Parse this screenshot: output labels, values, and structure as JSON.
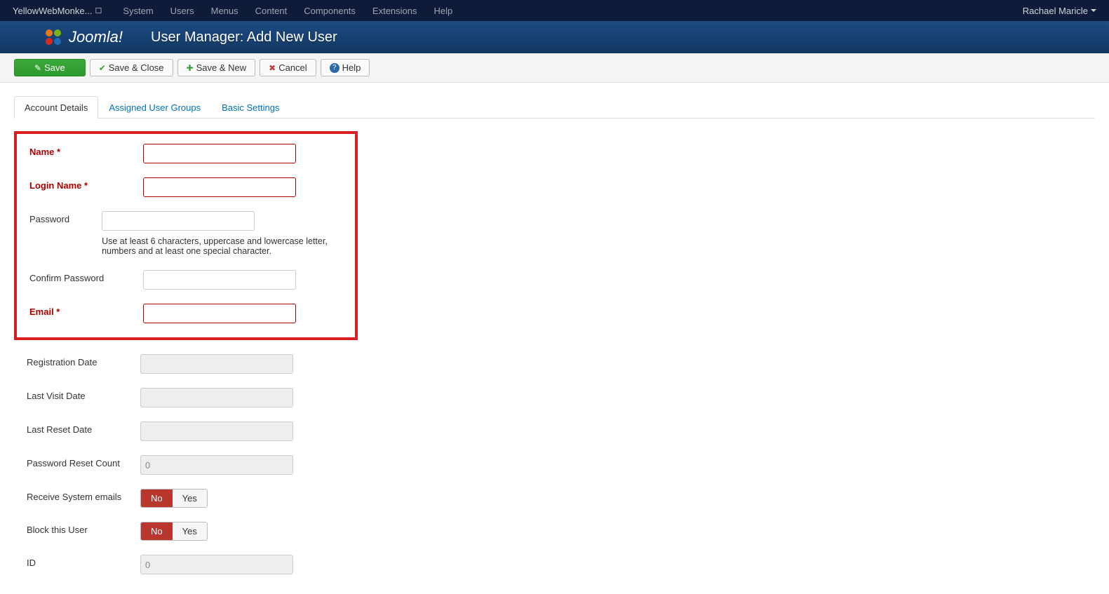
{
  "topbar": {
    "site": "YellowWebMonke...",
    "ext_icon": "↗",
    "menu": [
      "System",
      "Users",
      "Menus",
      "Content",
      "Components",
      "Extensions",
      "Help"
    ],
    "user": "Rachael Maricle"
  },
  "header": {
    "brand": "Joomla!",
    "title": "User Manager: Add New User"
  },
  "toolbar": {
    "save": "Save",
    "save_close": "Save & Close",
    "save_new": "Save & New",
    "cancel": "Cancel",
    "help": "Help"
  },
  "tabs": [
    "Account Details",
    "Assigned User Groups",
    "Basic Settings"
  ],
  "form": {
    "name": {
      "label": "Name *"
    },
    "login": {
      "label": "Login Name *"
    },
    "password": {
      "label": "Password",
      "hint": "Use at least 6 characters, uppercase and lowercase letter, numbers and at least one special character."
    },
    "confirm": {
      "label": "Confirm Password"
    },
    "email": {
      "label": "Email *"
    },
    "reg_date": {
      "label": "Registration Date",
      "value": ""
    },
    "last_visit": {
      "label": "Last Visit Date",
      "value": ""
    },
    "last_reset": {
      "label": "Last Reset Date",
      "value": ""
    },
    "reset_count": {
      "label": "Password Reset Count",
      "value": "0"
    },
    "receive": {
      "label": "Receive System emails",
      "no": "No",
      "yes": "Yes"
    },
    "block": {
      "label": "Block this User",
      "no": "No",
      "yes": "Yes"
    },
    "id": {
      "label": "ID",
      "value": "0"
    }
  }
}
